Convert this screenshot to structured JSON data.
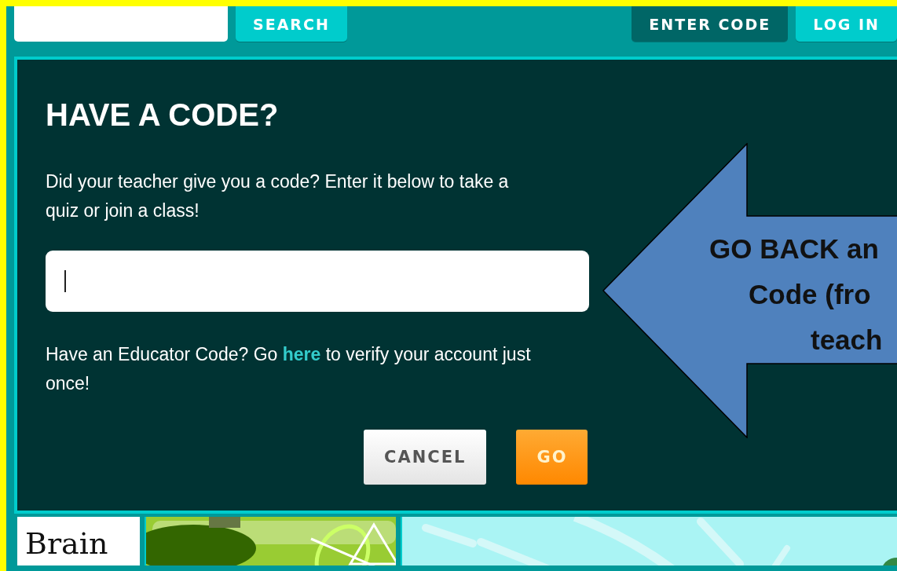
{
  "header": {
    "search_button": "SEARCH",
    "nav": [
      {
        "label": "ENTER CODE",
        "selected": true
      },
      {
        "label": "LOG IN",
        "selected": false
      }
    ]
  },
  "dialog": {
    "title": "HAVE A CODE?",
    "intro": "Did your teacher give you a code? Enter it below to take a quiz or join a class!",
    "code_field": {
      "focused": true
    },
    "educator_note": {
      "before": "Have an Educator Code? Go",
      "link": "here",
      "after": "to verify your account just once!"
    },
    "buttons": [
      {
        "label": "CANCEL",
        "kind": "secondary"
      },
      {
        "label": "GO",
        "kind": "primary"
      }
    ]
  },
  "callout": {
    "lines": [
      "GO BACK an",
      "Code (fro",
      "teach"
    ]
  },
  "tiles": [
    {
      "kind": "logo",
      "label": "Brain"
    },
    {
      "kind": "plant"
    },
    {
      "kind": "sky"
    }
  ]
}
